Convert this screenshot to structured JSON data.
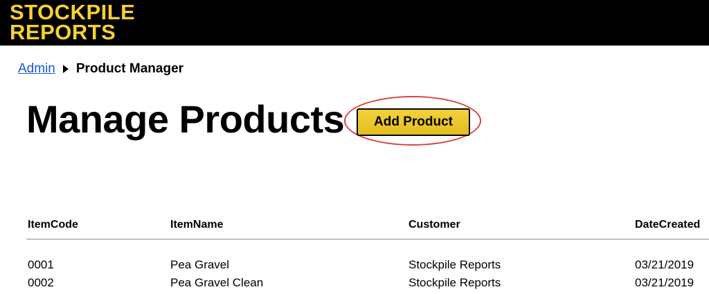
{
  "header": {
    "logo_line1": "STOCKPILE",
    "logo_line2": "REPORTS",
    "logo_color": "#f5d132"
  },
  "breadcrumb": {
    "parent": "Admin",
    "current": "Product Manager"
  },
  "page": {
    "title": "Manage Products",
    "add_button_label": "Add Product"
  },
  "table": {
    "columns": [
      "ItemCode",
      "ItemName",
      "Customer",
      "DateCreated"
    ],
    "rows": [
      [
        "0001",
        "Pea Gravel",
        "Stockpile Reports",
        "03/21/2019"
      ],
      [
        "0002",
        "Pea Gravel Clean",
        "Stockpile Reports",
        "03/21/2019"
      ]
    ]
  },
  "colors": {
    "header_bg": "#000000",
    "accent": "#e8c52a",
    "link": "#1a55d6",
    "highlight": "#d9433a"
  }
}
